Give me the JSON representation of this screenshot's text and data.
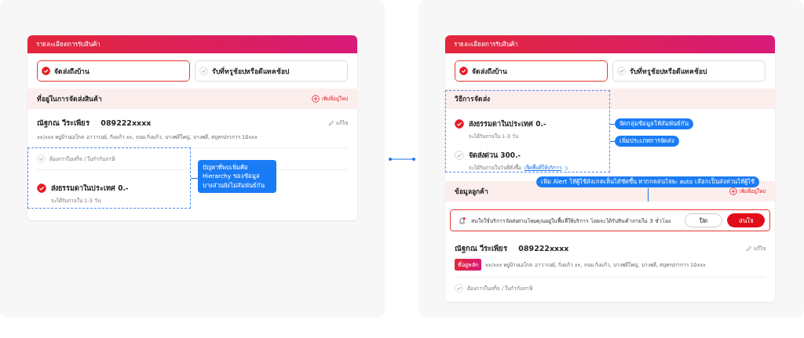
{
  "panels": [
    {
      "header": "รายละเอียดการรับสินค้า",
      "delivery_options": [
        {
          "label": "จัดส่งถึงบ้าน",
          "selected": true
        },
        {
          "label": "รับที่ทรูช้อปหรือดีแทคช้อป",
          "selected": false
        }
      ],
      "blocks": [
        {
          "kind": "section",
          "title": "ที่อยู่ในการจัดส่งสินค้า",
          "add_label": "เพิ่มที่อยู่ใหม่"
        },
        {
          "kind": "customer",
          "name": "ณัฐกณ วีระเพียร",
          "phone": "089222xxxx",
          "edit_label": "แก้ไข",
          "address": "xx/xxx หมู่บ้านเอโกล อาวาเนย์, กิ่งแก้ว xx, ถนน กิ่งแก้ว, บางพลีใหญ่, บางพลี, สมุทรปราการ 10xxx"
        },
        {
          "kind": "checkbox",
          "label": "ต้องการใบเสร็จ / ใบกำกับภาษี",
          "checked": false
        },
        {
          "kind": "shipping",
          "options": [
            {
              "title": "ส่งธรรมดาในประเทศ 0.-",
              "subtitle": "จะได้รับภายใน 1-3 วัน",
              "selected": true
            }
          ]
        }
      ],
      "notes": [
        "ปัญหาที่พบเพิ่มคือ Hierarchy ของข้อมูล บางส่วนยังไม่สัมพันธ์กัน"
      ]
    },
    {
      "header": "รายละเอียดการรับสินค้า",
      "delivery_options": [
        {
          "label": "จัดส่งถึงบ้าน",
          "selected": true
        },
        {
          "label": "รับที่ทรูช้อปหรือดีแทคช้อป",
          "selected": false
        }
      ],
      "blocks": [
        {
          "kind": "section",
          "title": "วิธีการจัดส่ง"
        },
        {
          "kind": "shipping",
          "options": [
            {
              "title": "ส่งธรรมดาในประเทศ 0.-",
              "subtitle": "จะได้รับภายใน 1-3 วัน",
              "selected": true
            },
            {
              "title": "จัดส่งด่วน 300.-",
              "subtitle": "จะได้รับภายในวันที่สั่งซื้อ",
              "link": "เช็คพื้นที่ให้บริการ",
              "selected": false
            }
          ]
        },
        {
          "kind": "section",
          "title": "ข้อมูลลูกค้า",
          "add_label": "เพิ่มที่อยู่ใหม่"
        },
        {
          "kind": "alert",
          "message": "สนใจใช้บริการจัดส่งด่วนไหมคุณอยู่ในพื้นที่ให้บริการ โดยจะได้รับสินค้าภายใน 3 ชั่วโมง",
          "dismiss": "ปิด",
          "accept": "สนใจ"
        },
        {
          "kind": "customer",
          "name": "ณัฐกณ วีระเพียร",
          "phone": "089222xxxx",
          "edit_label": "แก้ไข",
          "tag": "ที่อยู่หลัก",
          "address": "xx/xxx หมู่บ้านเอโกล อาวาเนย์, กิ่งแก้ว xx, ถนน กิ่งแก้ว, บางพลีใหญ่, บางพลี, สมุทรปราการ 10xxx"
        },
        {
          "kind": "checkbox",
          "label": "ต้องการใบเสร็จ / ใบกำกับภาษี",
          "checked": false
        }
      ],
      "notes": [
        "จัดกลุ่มข้อมูลให้สัมพันธ์กัน",
        "เพิ่มประเภทการจัดส่ง",
        "เพิ่ม Alert ให้ผู้ใช้สังเกตเห็นได้ชัดขึ้น หากกดสนใจจะ auto เลือกเป็นส่งด่วนให้ผู้ใช้"
      ]
    }
  ]
}
